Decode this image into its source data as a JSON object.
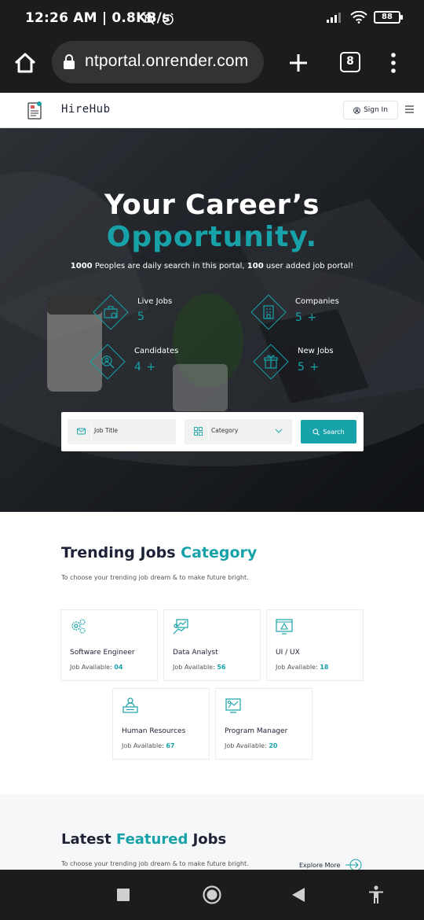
{
  "status_bar": {
    "time": "12:26 AM | 0.8KB/s",
    "battery": "88"
  },
  "browser": {
    "url": "ntportal.onrender.com",
    "tab_count": "8"
  },
  "header": {
    "logo_text": "HireHub",
    "signin_label": "Sign In"
  },
  "hero": {
    "title_line1": "Your Career’s",
    "title_line2": "Opportunity.",
    "subtitle_num1": "1000",
    "subtitle_part1": " Peoples are daily search in this portal, ",
    "subtitle_num2": "100",
    "subtitle_part2": " user added job portal!",
    "stats": [
      {
        "label": "Live Jobs",
        "value": "5"
      },
      {
        "label": "Companies",
        "value": "5 +"
      },
      {
        "label": "Candidates",
        "value": "4 +"
      },
      {
        "label": "New Jobs",
        "value": "5 +"
      }
    ],
    "search": {
      "job_title_placeholder": "Job Title",
      "category_placeholder": "Category",
      "button_label": "Search"
    }
  },
  "trending": {
    "title_part1": "Trending Jobs ",
    "title_accent": "Category",
    "subtitle": "To choose your trending job dream & to make future bright.",
    "categories": [
      {
        "name": "Software Engineer",
        "count_label": "Job Available: ",
        "count": "04",
        "icon": "gears-icon"
      },
      {
        "name": "Data Analyst",
        "count_label": "Job Available: ",
        "count": "56",
        "icon": "data-analyst-icon"
      },
      {
        "name": "UI / UX",
        "count_label": "Job Available: ",
        "count": "18",
        "icon": "design-icon"
      },
      {
        "name": "Human Resources",
        "count_label": "Job Available: ",
        "count": "67",
        "icon": "hr-icon"
      },
      {
        "name": "Program Manager",
        "count_label": "Job Available: ",
        "count": "20",
        "icon": "manager-icon"
      }
    ]
  },
  "featured": {
    "title_part1": "Latest ",
    "title_accent": "Featured",
    "title_part2": " Jobs",
    "subtitle": "To choose your trending job dream & to make future bright.",
    "explore_label": "Explore More"
  },
  "colors": {
    "accent": "#17a2a9",
    "dark": "#1d2236"
  }
}
